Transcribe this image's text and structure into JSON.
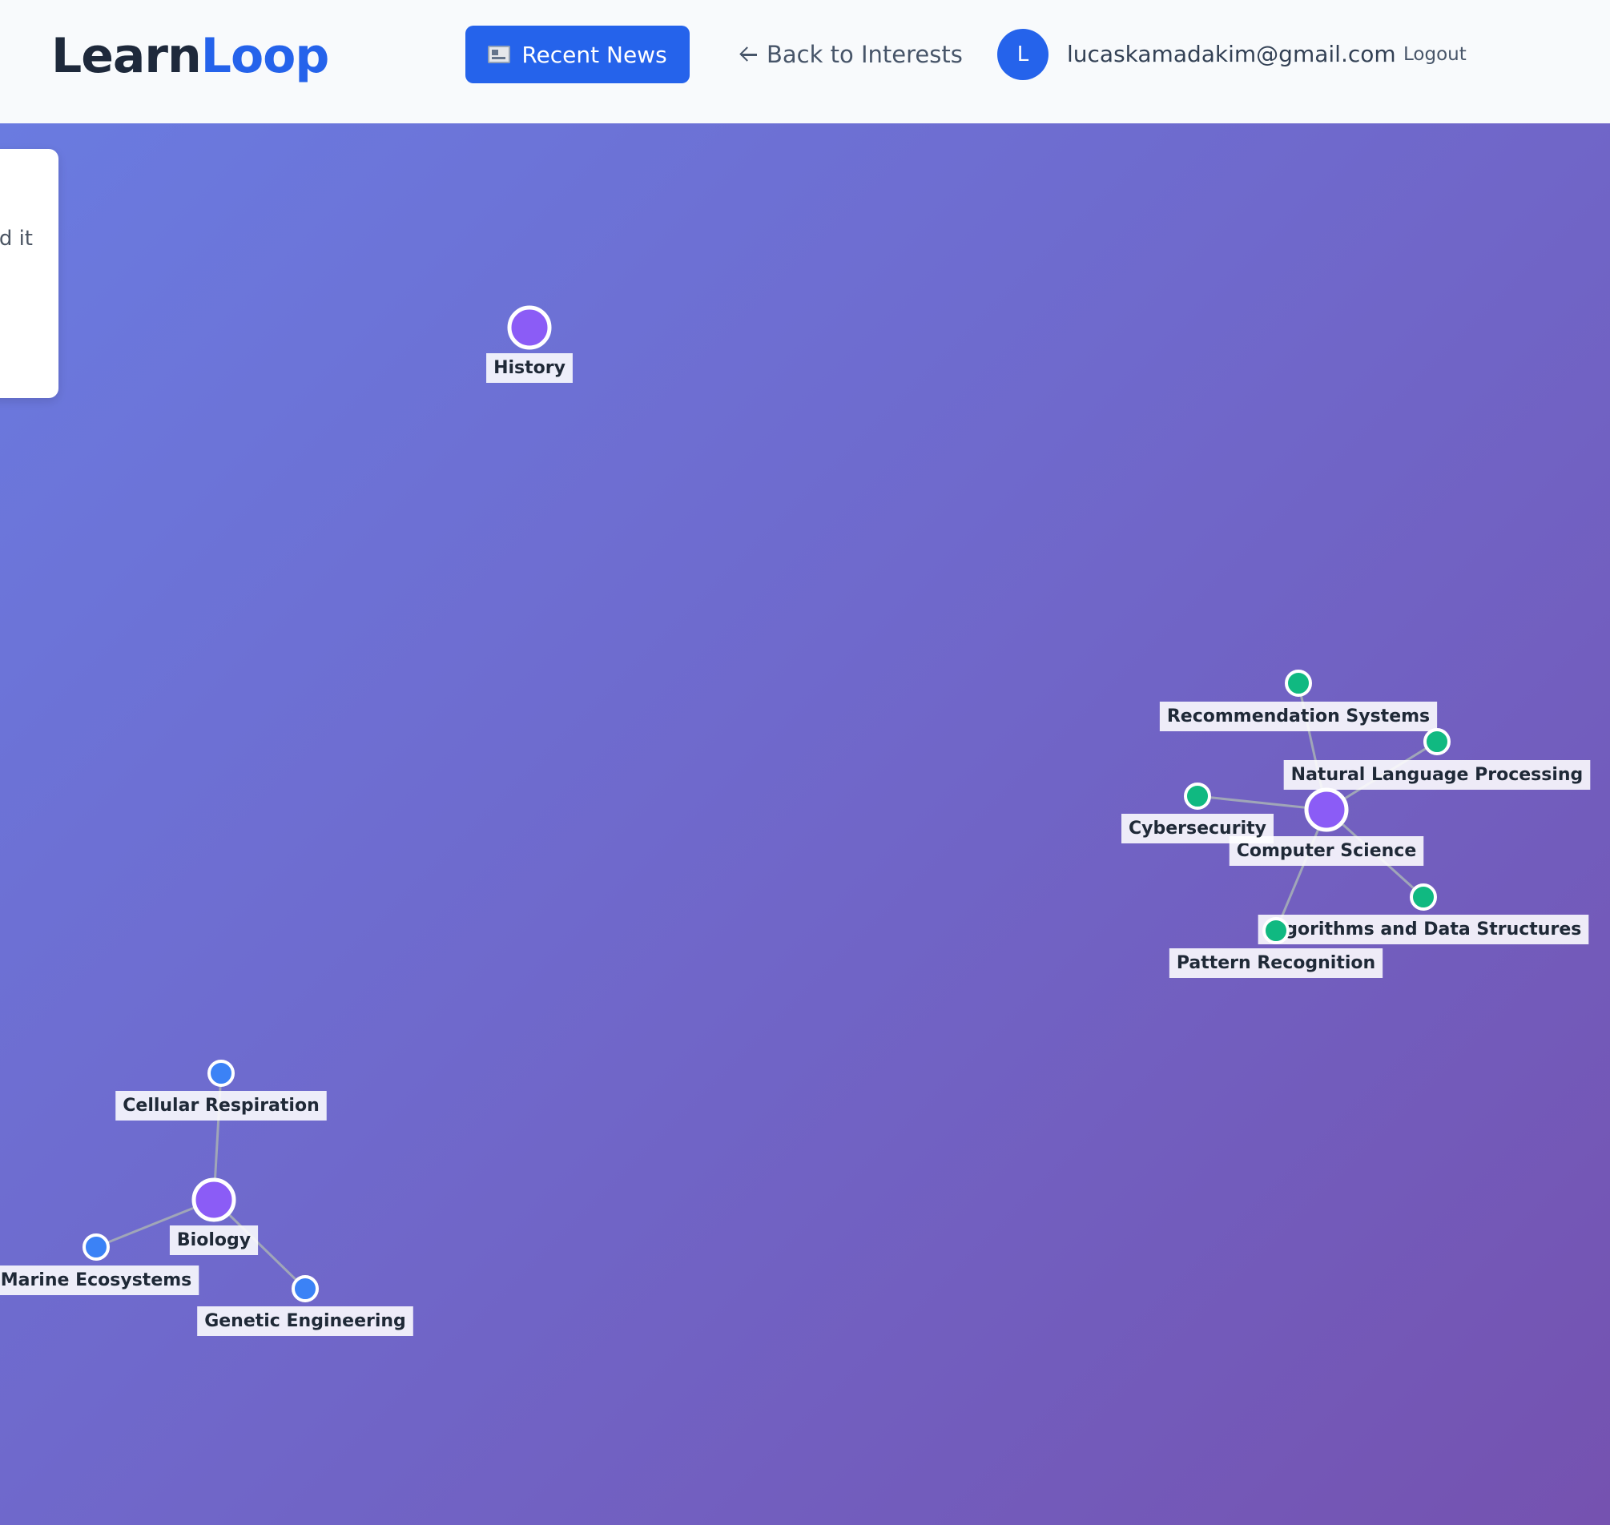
{
  "header": {
    "logo_part1": "Learn",
    "logo_part2": "Loop",
    "news_button_label": "Recent News",
    "back_link_label": "Back to Interests",
    "avatar_initial": "L",
    "user_email": "lucaskamadakim@gmail.com",
    "logout_label": "Logout"
  },
  "side_card": {
    "visible_text": "d it"
  },
  "graph": {
    "colors": {
      "root": "#8b5cf6",
      "cs_child": "#10b981",
      "bio_child": "#3b82f6",
      "node_stroke": "#ffffff"
    },
    "nodes": [
      {
        "id": "history",
        "label": "History",
        "kind": "root"
      },
      {
        "id": "computer-science",
        "label": "Computer Science",
        "kind": "root"
      },
      {
        "id": "recommendation-systems",
        "label": "Recommendation Systems",
        "kind": "cs_child"
      },
      {
        "id": "natural-language-processing",
        "label": "Natural Language Processing",
        "kind": "cs_child"
      },
      {
        "id": "cybersecurity",
        "label": "Cybersecurity",
        "kind": "cs_child"
      },
      {
        "id": "algorithms-and-data-structures",
        "label": "Algorithms and Data Structures",
        "kind": "cs_child"
      },
      {
        "id": "pattern-recognition",
        "label": "Pattern Recognition",
        "kind": "cs_child"
      },
      {
        "id": "biology",
        "label": "Biology",
        "kind": "root"
      },
      {
        "id": "cellular-respiration",
        "label": "Cellular Respiration",
        "kind": "bio_child"
      },
      {
        "id": "marine-ecosystems",
        "label": "Marine Ecosystems",
        "kind": "bio_child"
      },
      {
        "id": "genetic-engineering",
        "label": "Genetic Engineering",
        "kind": "bio_child"
      }
    ],
    "edges": [
      [
        "computer-science",
        "recommendation-systems"
      ],
      [
        "computer-science",
        "natural-language-processing"
      ],
      [
        "computer-science",
        "cybersecurity"
      ],
      [
        "computer-science",
        "algorithms-and-data-structures"
      ],
      [
        "computer-science",
        "pattern-recognition"
      ],
      [
        "biology",
        "cellular-respiration"
      ],
      [
        "biology",
        "marine-ecosystems"
      ],
      [
        "biology",
        "genetic-engineering"
      ]
    ]
  }
}
